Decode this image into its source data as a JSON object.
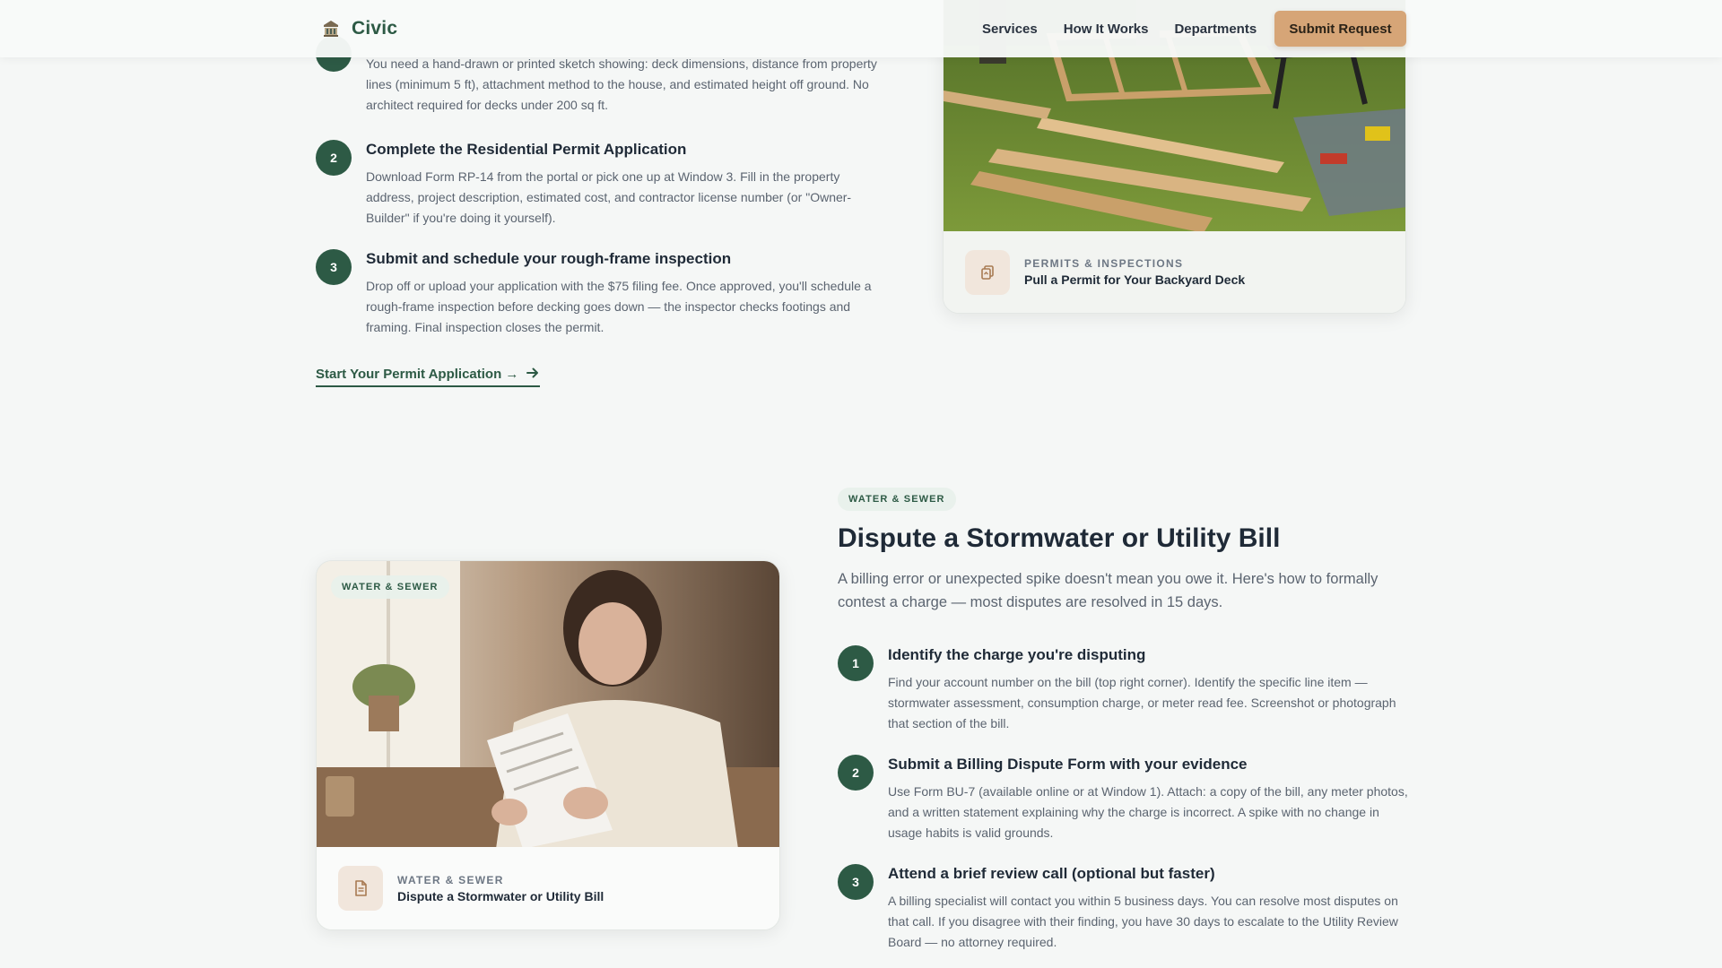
{
  "header": {
    "brand": "Civic",
    "nav": [
      "Services",
      "How It Works",
      "Departments"
    ],
    "cta": "Submit Request"
  },
  "permit_section": {
    "steps": [
      {
        "number": "",
        "title": "",
        "description": "You need a hand-drawn or printed sketch showing: deck dimensions, distance from property lines (minimum 5 ft), attachment method to the house, and estimated height off ground. No architect required for decks under 200 sq ft."
      },
      {
        "number": "2",
        "title": "Complete the Residential Permit Application",
        "description": "Download Form RP-14 from the portal or pick one up at Window 3. Fill in the property address, project description, estimated cost, and contractor license number (or \"Owner-Builder\" if you're doing it yourself)."
      },
      {
        "number": "3",
        "title": "Submit and schedule your rough-frame inspection",
        "description": "Drop off or upload your application with the $75 filing fee. Once approved, you'll schedule a rough-frame inspection before decking goes down — the inspector checks footings and framing. Final inspection closes the permit."
      }
    ],
    "link": "Start Your Permit Application →",
    "card": {
      "category": "PERMITS & INSPECTIONS",
      "title": "Pull a Permit for Your Backyard Deck"
    }
  },
  "utility_section": {
    "tag": "WATER & SEWER",
    "title": "Dispute a Stormwater or Utility Bill",
    "intro": "A billing error or unexpected spike doesn't mean you owe it. Here's how to formally contest a charge — most disputes are resolved in 15 days.",
    "card": {
      "badge": "WATER & SEWER",
      "category": "WATER & SEWER",
      "title": "Dispute a Stormwater or Utility Bill"
    },
    "steps": [
      {
        "number": "1",
        "title": "Identify the charge you're disputing",
        "description": "Find your account number on the bill (top right corner). Identify the specific line item — stormwater assessment, consumption charge, or meter read fee. Screenshot or photograph that section of the bill."
      },
      {
        "number": "2",
        "title": "Submit a Billing Dispute Form with your evidence",
        "description": "Use Form BU-7 (available online or at Window 1). Attach: a copy of the bill, any meter photos, and a written statement explaining why the charge is incorrect. A spike with no change in usage habits is valid grounds."
      },
      {
        "number": "3",
        "title": "Attend a brief review call (optional but faster)",
        "description": "A billing specialist will contact you within 5 business days. You can resolve most disputes on that call. If you disagree with their finding, you have 30 days to escalate to the Utility Review Board — no attorney required."
      }
    ]
  },
  "icons": [
    "civic-building-icon",
    "arrow-right-icon",
    "copy-documents-icon",
    "document-icon"
  ],
  "colors": {
    "accent_green": "#2d5a45",
    "cta_tan": "#d6a577",
    "page_background": "#f5f7f6"
  }
}
